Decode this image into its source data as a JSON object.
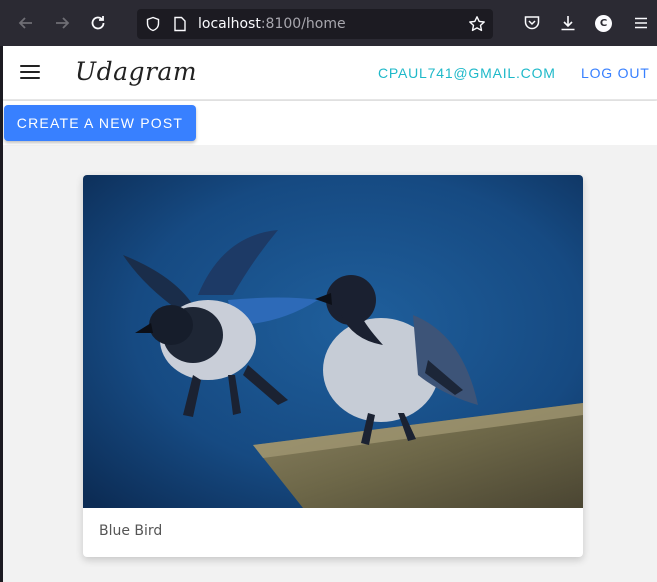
{
  "browser": {
    "url_host": "localhost",
    "url_rest": ":8100/home",
    "account_initial": "C"
  },
  "header": {
    "brand": "Udagram",
    "user_email": "CPAUL741@GMAIL.COM",
    "logout": "LOG OUT"
  },
  "toolbar": {
    "create_label": "CREATE A NEW POST"
  },
  "feed": {
    "items": [
      {
        "caption": "Blue Bird",
        "image_icon": "crows-photo"
      }
    ]
  },
  "colors": {
    "primary": "#3880ff",
    "secondary": "#1fb9c9",
    "browser_bg": "#2b2a33"
  }
}
